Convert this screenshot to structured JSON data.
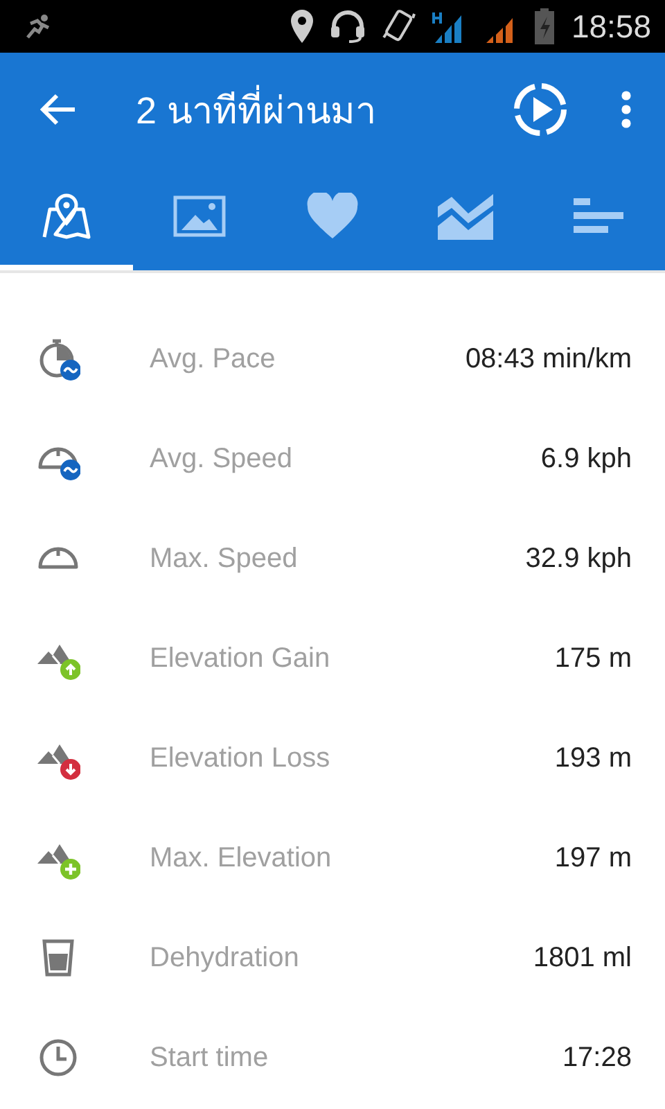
{
  "status_bar": {
    "time": "18:58"
  },
  "toolbar": {
    "title": "2 นาทีที่ผ่านมา"
  },
  "tabs": [
    {
      "kind": "map",
      "selected": true
    },
    {
      "kind": "photo",
      "selected": false
    },
    {
      "kind": "heart",
      "selected": false
    },
    {
      "kind": "chart",
      "selected": false
    },
    {
      "kind": "bars",
      "selected": false
    }
  ],
  "stats": [
    {
      "kind": "pace",
      "label": "Avg. Pace",
      "value": "08:43 min/km"
    },
    {
      "kind": "avg-speed",
      "label": "Avg. Speed",
      "value": "6.9 kph"
    },
    {
      "kind": "max-speed",
      "label": "Max. Speed",
      "value": "32.9 kph"
    },
    {
      "kind": "elev-gain",
      "label": "Elevation Gain",
      "value": "175 m"
    },
    {
      "kind": "elev-loss",
      "label": "Elevation Loss",
      "value": "193 m"
    },
    {
      "kind": "elev-max",
      "label": "Max. Elevation",
      "value": "197 m"
    },
    {
      "kind": "dehydration",
      "label": "Dehydration",
      "value": "1801 ml"
    },
    {
      "kind": "start-time",
      "label": "Start time",
      "value": "17:28"
    }
  ]
}
